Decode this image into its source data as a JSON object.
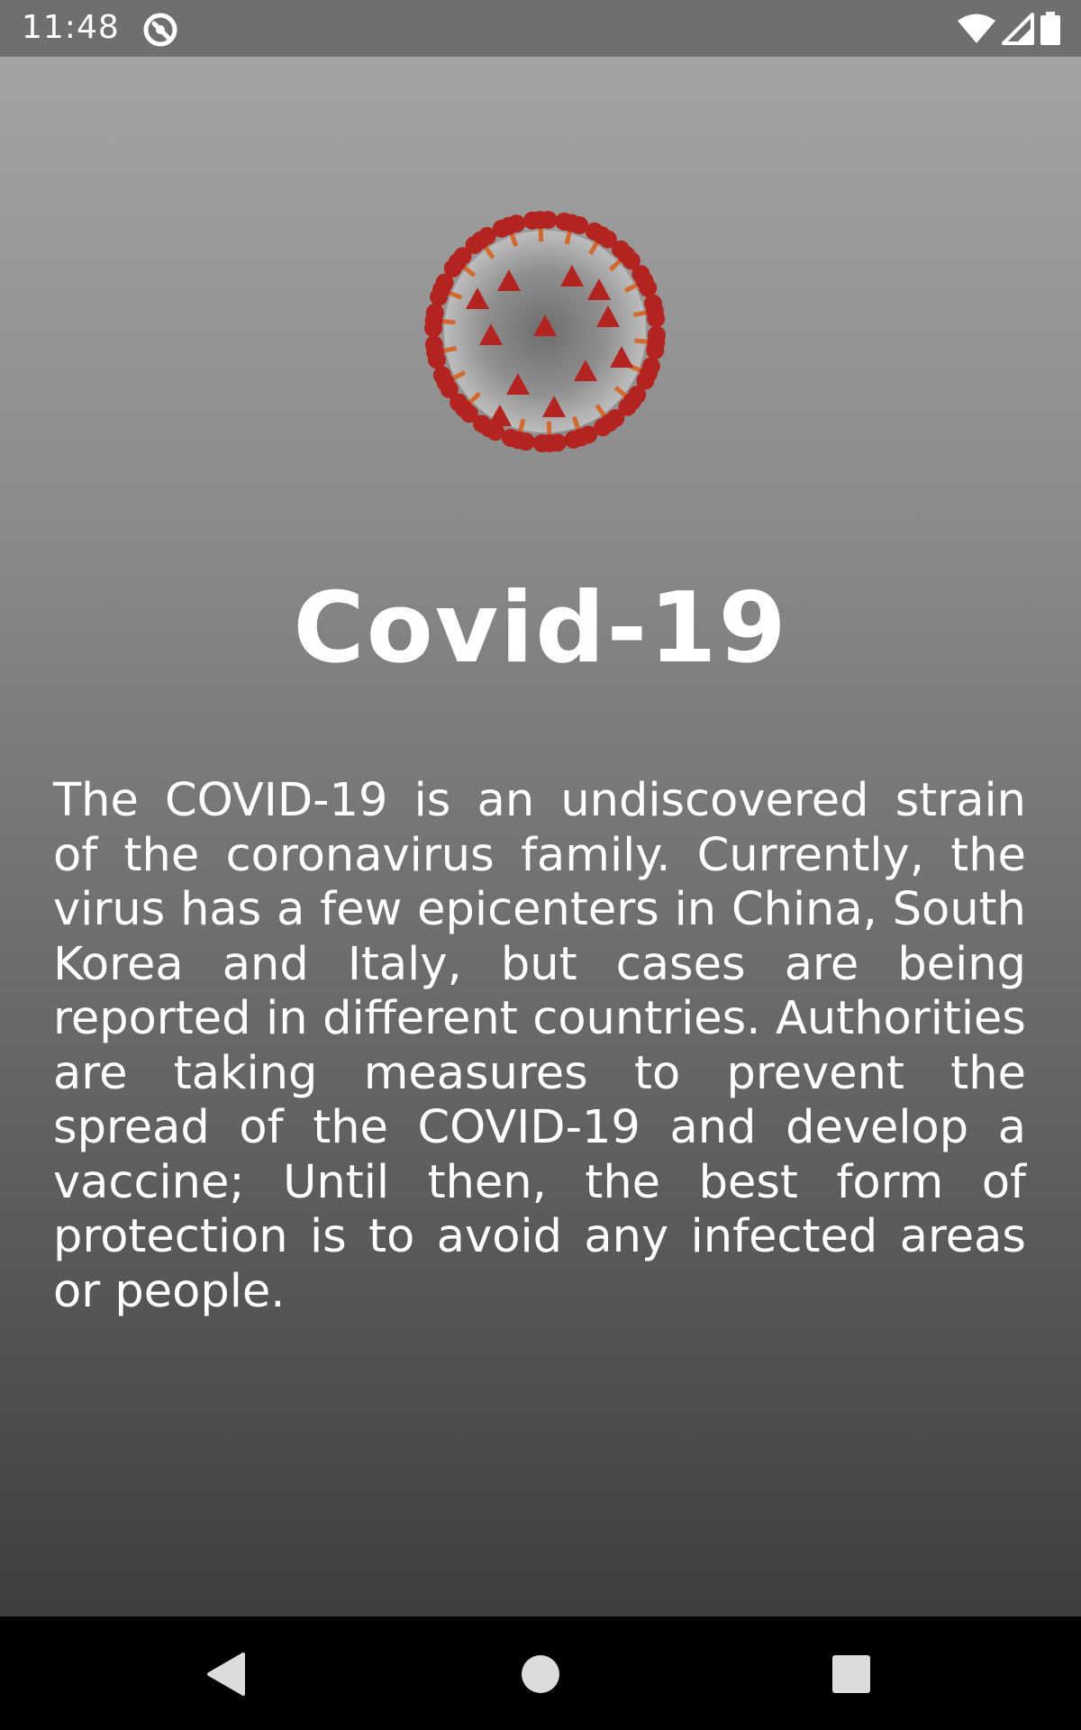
{
  "status_bar": {
    "time": "11:48",
    "icons": [
      "notification-app-icon",
      "wifi-icon",
      "cell-signal-icon",
      "battery-icon"
    ]
  },
  "main": {
    "image": "coronavirus-illustration",
    "title": "Covid-19",
    "description": "The COVID-19 is an undiscovered strain of the coronavirus family. Currently, the virus has a few epicenters in China, South Korea and Italy, but cases are being reported in different countries. Authorities are taking measures to prevent the spread of the COVID-19 and develop a vaccine; Until then, the best form of protection is to avoid any infected areas or people."
  },
  "nav_bar": {
    "buttons": [
      "back-icon",
      "home-icon",
      "recents-icon"
    ]
  },
  "colors": {
    "status_bar": "#6f6f6f",
    "gradient_top": "#a3a3a3",
    "gradient_bottom": "#3e3e3e",
    "text": "#ffffff",
    "nav_bar": "#000000",
    "nav_icon": "#dcdcdc",
    "virus_spike": "#b3231f",
    "virus_body": "#8f8f8f"
  }
}
